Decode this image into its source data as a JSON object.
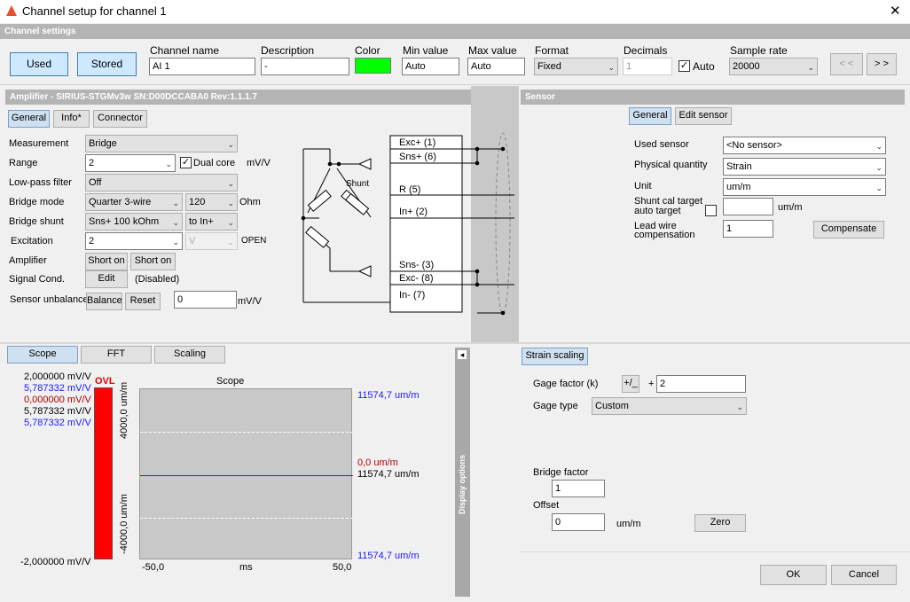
{
  "window": {
    "title": "Channel setup for channel 1",
    "close": "✕"
  },
  "channel_settings": {
    "header": "Channel settings",
    "used_label": "Used",
    "stored_label": "Stored",
    "channel_name_label": "Channel name",
    "channel_name": "AI 1",
    "description_label": "Description",
    "description": "-",
    "color_label": "Color",
    "color": "#00ff00",
    "min_label": "Min value",
    "min_value": "Auto",
    "max_label": "Max value",
    "max_value": "Auto",
    "format_label": "Format",
    "format": "Fixed",
    "decimals_label": "Decimals",
    "decimals": "1",
    "auto_label": "Auto",
    "sample_rate_label": "Sample rate",
    "sample_rate": "20000",
    "prev_label": "< <",
    "next_label": "> >"
  },
  "amplifier": {
    "header": "Amplifier - SIRIUS-STGMv3w  SN:D00DCCABA0 Rev:1.1.1.7",
    "tabs": [
      "General",
      "Info*",
      "Connector"
    ],
    "measurement_label": "Measurement",
    "measurement": "Bridge",
    "range_label": "Range",
    "range": "2",
    "dual_core_label": "Dual core",
    "range_unit": "mV/V",
    "lowpass_label": "Low-pass filter",
    "lowpass": "Off",
    "bridge_mode_label": "Bridge mode",
    "bridge_mode": "Quarter 3-wire",
    "bridge_res": "120",
    "ohm": "Ohm",
    "shunt_label": "Bridge shunt",
    "shunt": "Sns+ 100 kOhm",
    "shunt_target": "to In+",
    "excitation_label": "Excitation",
    "excitation": "2",
    "excitation_unit": "V",
    "open": "OPEN",
    "amplifier_label": "Amplifier",
    "short_on_1": "Short on",
    "short_on_2": "Short on",
    "signal_label": "Signal Cond.",
    "edit": "Edit",
    "disabled": "(Disabled)",
    "unbalance_label": "Sensor unbalance",
    "balance": "Balance",
    "reset": "Reset",
    "unbalance_value": "0",
    "unbalance_unit": "mV/V"
  },
  "diagram": {
    "pins": [
      "Exc+ (1)",
      "Sns+ (6)",
      "R (5)",
      "In+ (2)",
      "Sns- (3)",
      "Exc- (8)",
      "In- (7)"
    ],
    "shunt_text": "Shunt"
  },
  "sensor": {
    "header": "Sensor",
    "tabs": [
      "General",
      "Edit sensor"
    ],
    "used_sensor_label": "Used sensor",
    "used_sensor": "<No sensor>",
    "physical_label": "Physical quantity",
    "physical": "Strain",
    "unit_label": "Unit",
    "unit": "um/m",
    "shunt_cal_label_1": "Shunt cal target",
    "shunt_cal_label_2": "auto target",
    "shunt_cal_unit": "um/m",
    "lead_wire_label_1": "Lead wire",
    "lead_wire_label_2": "compensation",
    "lead_wire_value": "1",
    "compensate": "Compensate"
  },
  "scope": {
    "tabs": [
      "Scope",
      "FFT",
      "Scaling"
    ],
    "title": "Scope",
    "left_values": [
      {
        "text": "2,000000 mV/V",
        "color": "#000000"
      },
      {
        "text": "5,787332 mV/V",
        "color": "#1a1aff"
      },
      {
        "text": "0,000000 mV/V",
        "color": "#b00000"
      },
      {
        "text": "5,787332 mV/V",
        "color": "#000000"
      },
      {
        "text": "5,787332 mV/V",
        "color": "#1a1aff"
      }
    ],
    "bottom_left": "-2,000000 mV/V",
    "ovl": "OVL",
    "y_top": "4000,0 um/m",
    "y_bottom": "-4000,0 um/m",
    "right_top": "11574,7 um/m",
    "right_mid_red": "0,0 um/m",
    "right_mid": "11574,7 um/m",
    "right_bottom": "11574,7 um/m",
    "x_min": "-50,0",
    "x_unit": "ms",
    "x_max": "50,0",
    "display_options": "Display options",
    "collapse": "◂"
  },
  "strain": {
    "tab": "Strain scaling",
    "gage_factor_label": "Gage factor (k)",
    "plus_minus": "+/_",
    "plus": "+",
    "gage_factor": "2",
    "gage_type_label": "Gage type",
    "gage_type": "Custom",
    "bridge_factor_label": "Bridge factor",
    "bridge_factor": "1",
    "offset_label": "Offset",
    "offset": "0",
    "offset_unit": "um/m",
    "zero": "Zero"
  },
  "footer": {
    "ok": "OK",
    "cancel": "Cancel"
  }
}
